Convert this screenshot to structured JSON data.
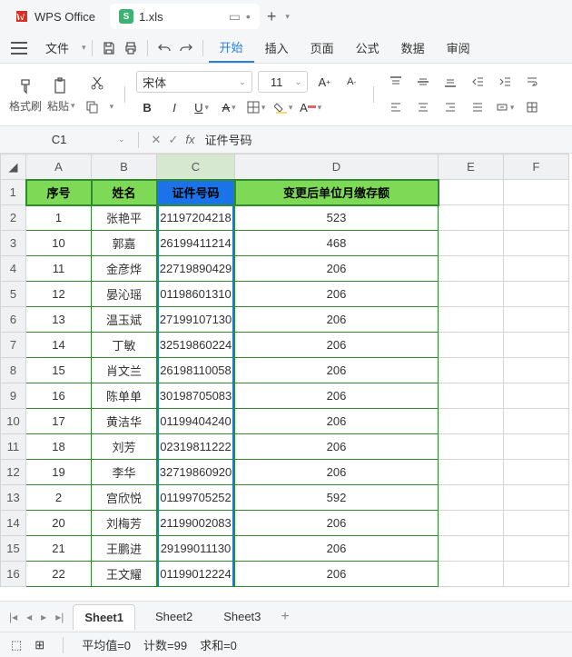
{
  "app": {
    "name": "WPS Office"
  },
  "file": {
    "badge": "S",
    "name": "1.xls"
  },
  "menubar": {
    "file": "文件",
    "items": [
      "开始",
      "插入",
      "页面",
      "公式",
      "数据",
      "审阅"
    ],
    "active": 0
  },
  "ribbon": {
    "format_brush": "格式刷",
    "paste": "粘贴",
    "font_name": "宋体",
    "font_size": "11"
  },
  "formula": {
    "cell_ref": "C1",
    "fx": "fx",
    "value": "证件号码"
  },
  "columns": [
    "A",
    "B",
    "C",
    "D",
    "E",
    "F"
  ],
  "headers": [
    "序号",
    "姓名",
    "证件号码",
    "变更后单位月缴存额"
  ],
  "rows": [
    {
      "n": 1,
      "a": "1",
      "b": "张艳平",
      "c": "21197204218",
      "d": "523"
    },
    {
      "n": 2,
      "a": "10",
      "b": "郭嘉",
      "c": "26199411214",
      "d": "468"
    },
    {
      "n": 3,
      "a": "11",
      "b": "金彦烨",
      "c": "22719890429",
      "d": "206"
    },
    {
      "n": 4,
      "a": "12",
      "b": "晏沁瑶",
      "c": "01198601310",
      "d": "206"
    },
    {
      "n": 5,
      "a": "13",
      "b": "温玉斌",
      "c": "27199107130",
      "d": "206"
    },
    {
      "n": 6,
      "a": "14",
      "b": "丁敏",
      "c": "32519860224",
      "d": "206"
    },
    {
      "n": 7,
      "a": "15",
      "b": "肖文兰",
      "c": "26198110058",
      "d": "206"
    },
    {
      "n": 8,
      "a": "16",
      "b": "陈单单",
      "c": "30198705083",
      "d": "206"
    },
    {
      "n": 9,
      "a": "17",
      "b": "黄洁华",
      "c": "01199404240",
      "d": "206"
    },
    {
      "n": 10,
      "a": "18",
      "b": "刘芳",
      "c": "02319811222",
      "d": "206"
    },
    {
      "n": 11,
      "a": "19",
      "b": "李华",
      "c": "32719860920",
      "d": "206"
    },
    {
      "n": 12,
      "a": "2",
      "b": "宫欣悦",
      "c": "01199705252",
      "d": "592"
    },
    {
      "n": 13,
      "a": "20",
      "b": "刘梅芳",
      "c": "21199002083",
      "d": "206"
    },
    {
      "n": 14,
      "a": "21",
      "b": "王鹏进",
      "c": "29199011130",
      "d": "206"
    },
    {
      "n": 15,
      "a": "22",
      "b": "王文耀",
      "c": "01199012224",
      "d": "206"
    }
  ],
  "sheets": {
    "items": [
      "Sheet1",
      "Sheet2",
      "Sheet3"
    ],
    "active": 0
  },
  "status": {
    "avg": "平均值=0",
    "count": "计数=99",
    "sum": "求和=0"
  }
}
